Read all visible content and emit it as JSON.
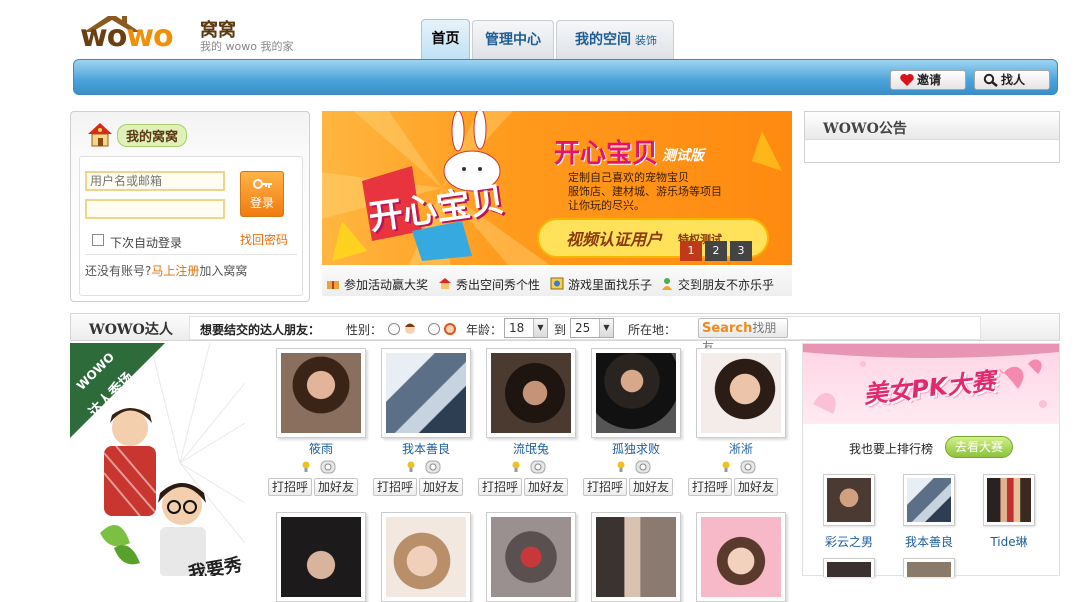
{
  "header": {
    "logo_text": "wowo",
    "logo_cn": "窝窝",
    "logo_sub": "我的 wowo 我的家",
    "tabs": [
      {
        "label": "首页",
        "active": true
      },
      {
        "label": "管理中心",
        "active": false
      },
      {
        "label": "我的空间",
        "active": false
      }
    ],
    "tab_extra": "装饰",
    "nav_buttons": [
      {
        "label": "邀请",
        "icon": "heart-icon"
      },
      {
        "label": "找人",
        "icon": "search-icon"
      }
    ]
  },
  "login": {
    "title": "我的窝窝",
    "username_placeholder": "用户名或邮箱",
    "password_placeholder": "",
    "login_button": "登录",
    "remember_label": "下次自动登录",
    "forgot_link": "找回密码",
    "no_account_text": "还没有账号?",
    "register_link": "马上注册",
    "join_text": "加入窝窝"
  },
  "banner": {
    "title_main": "开心宝贝",
    "title_sub": "测试版",
    "logo_text": "开心宝贝",
    "desc_lines": [
      "定制自己喜欢的宠物宝贝",
      "服饰店、建材城、游乐场等项目",
      "让你玩的尽兴。"
    ],
    "verify_text": "视频认证用户",
    "verify_small": "特权测试",
    "pages": [
      "1",
      "2",
      "3"
    ],
    "strip": [
      "参加活动赢大奖",
      "秀出空间秀个性",
      "游戏里面找乐子",
      "交到朋友不亦乐乎"
    ]
  },
  "notice": {
    "title": "WOWO公告"
  },
  "search": {
    "section_title": "WOWO达人",
    "prompt": "想要结交的达人朋友：",
    "gender_label": "性别：",
    "age_label": "年龄：",
    "age_from": "18",
    "age_to_label": "到",
    "age_to": "25",
    "location_label": "所在地：",
    "search_button_en": "Search",
    "search_button_cn": "找朋友"
  },
  "promo": {
    "ribbon_line1": "WOWO",
    "ribbon_line2": "达人秀场",
    "name_fragment": "我要秀"
  },
  "users": {
    "row1": [
      {
        "name": "筱雨"
      },
      {
        "name": "我本善良"
      },
      {
        "name": "流氓兔"
      },
      {
        "name": "孤独求败"
      },
      {
        "name": "淅淅"
      }
    ],
    "row2": [
      {
        "name": ""
      },
      {
        "name": ""
      },
      {
        "name": ""
      },
      {
        "name": ""
      },
      {
        "name": ""
      }
    ],
    "action_greet": "打招呼",
    "action_add": "加好友"
  },
  "pk": {
    "banner_text": "美女PK大赛",
    "prompt": "我也要上排行榜",
    "button": "去看大赛",
    "thumbs": [
      {
        "name": "彩云之男"
      },
      {
        "name": "我本善良"
      },
      {
        "name": "Tide琳"
      }
    ]
  },
  "colors": {
    "nav_blue": "#4aa3da",
    "link_blue": "#1e5ea0",
    "orange": "#f07b10",
    "register_orange": "#e4700c",
    "pk_green": "#8cc23a"
  }
}
